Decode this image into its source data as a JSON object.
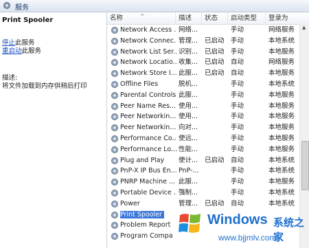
{
  "window": {
    "title": "服务"
  },
  "details": {
    "service_name": "Print Spooler",
    "stop_link": "停止",
    "stop_suffix": "此服务",
    "restart_link": "重启动",
    "restart_suffix": "此服务",
    "description_label": "描述:",
    "description_text": "将文件加载到内存供稍后打印"
  },
  "columns": {
    "name": "名称",
    "description": "描述",
    "status": "状态",
    "startup_type": "启动类型",
    "logon_as": "登录为"
  },
  "services": [
    {
      "name": "Network Access ...",
      "desc": "网络...",
      "status": "",
      "startup": "手动",
      "logon": "网络服务"
    },
    {
      "name": "Network Connec...",
      "desc": "管理...",
      "status": "已启动",
      "startup": "手动",
      "logon": "本地系统"
    },
    {
      "name": "Network List Ser...",
      "desc": "识别...",
      "status": "已启动",
      "startup": "手动",
      "logon": "本地服务"
    },
    {
      "name": "Network Locatio...",
      "desc": "收集...",
      "status": "已启动",
      "startup": "自动",
      "logon": "网络服务"
    },
    {
      "name": "Network Store I...",
      "desc": "此服...",
      "status": "已启动",
      "startup": "自动",
      "logon": "本地服务"
    },
    {
      "name": "Offline Files",
      "desc": "脱机...",
      "status": "",
      "startup": "手动",
      "logon": "本地系统"
    },
    {
      "name": "Parental Controls",
      "desc": "此服...",
      "status": "",
      "startup": "手动",
      "logon": "本地服务"
    },
    {
      "name": "Peer Name Res...",
      "desc": "使用...",
      "status": "",
      "startup": "手动",
      "logon": "本地服务"
    },
    {
      "name": "Peer Networkin...",
      "desc": "使用...",
      "status": "",
      "startup": "手动",
      "logon": "本地服务"
    },
    {
      "name": "Peer Networkin...",
      "desc": "向对...",
      "status": "",
      "startup": "手动",
      "logon": "本地服务"
    },
    {
      "name": "Performance Co...",
      "desc": "使远...",
      "status": "",
      "startup": "手动",
      "logon": "本地服务"
    },
    {
      "name": "Performance Lo...",
      "desc": "性能...",
      "status": "",
      "startup": "手动",
      "logon": "本地服务"
    },
    {
      "name": "Plug and Play",
      "desc": "使计...",
      "status": "已启动",
      "startup": "自动",
      "logon": "本地系统"
    },
    {
      "name": "PnP-X IP Bus En...",
      "desc": "PnP-...",
      "status": "",
      "startup": "手动",
      "logon": "本地系统"
    },
    {
      "name": "PNRP Machine ...",
      "desc": "此服...",
      "status": "",
      "startup": "手动",
      "logon": "本地服务"
    },
    {
      "name": "Portable Device ...",
      "desc": "强制...",
      "status": "",
      "startup": "手动",
      "logon": "本地系统"
    },
    {
      "name": "Power",
      "desc": "管理...",
      "status": "已启动",
      "startup": "自动",
      "logon": "本地系统"
    },
    {
      "name": "Print Spooler",
      "desc": "",
      "status": "",
      "startup": "",
      "logon": "",
      "selected": true
    },
    {
      "name": "Problem Report",
      "desc": "",
      "status": "",
      "startup": "",
      "logon": ""
    },
    {
      "name": "Program Compa",
      "desc": "",
      "status": "",
      "startup": "",
      "logon": ""
    }
  ],
  "watermark": {
    "brand": "Windows",
    "chinese": "系统之家",
    "url": "www.bjjmlv.com"
  },
  "colors": {
    "selection": "#3b77d9",
    "link": "#1a4fc4",
    "watermark": "#1d6fd0"
  }
}
